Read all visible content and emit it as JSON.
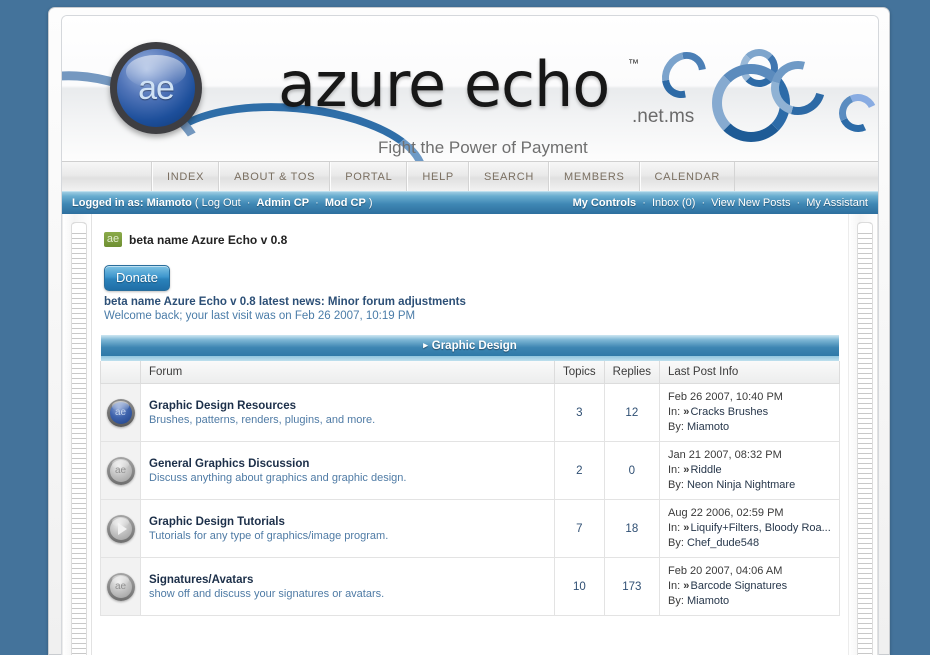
{
  "site": {
    "logo_text": "ae",
    "wordmark": "azure echo",
    "trademark": "™",
    "domain_suffix": ".net.ms",
    "tagline": "Fight the Power of Payment"
  },
  "nav": {
    "items": [
      {
        "label": "INDEX"
      },
      {
        "label": "ABOUT & TOS"
      },
      {
        "label": "PORTAL"
      },
      {
        "label": "HELP"
      },
      {
        "label": "SEARCH"
      },
      {
        "label": "MEMBERS"
      },
      {
        "label": "CALENDAR"
      }
    ]
  },
  "userbar": {
    "logged_in_label": "Logged in as:",
    "username": "Miamoto",
    "paren_open": "(",
    "logout": "Log Out",
    "admin_cp": "Admin CP",
    "mod_cp": "Mod CP",
    "paren_close": ")",
    "my_controls": "My Controls",
    "inbox": "Inbox (0)",
    "view_new_posts": "View New Posts",
    "my_assistant": "My Assistant",
    "separator": "·"
  },
  "board": {
    "badge": "ae",
    "title": "beta name Azure Echo v 0.8",
    "donate_label": "Donate",
    "news_line": "beta name Azure Echo v 0.8 latest news: Minor forum adjustments",
    "welcome_line": "Welcome back; your last visit was on Feb 26 2007, 10:19 PM"
  },
  "category": {
    "arrow": "▸",
    "name": "Graphic Design"
  },
  "table": {
    "headers": {
      "forum": "Forum",
      "topics": "Topics",
      "replies": "Replies",
      "last_post": "Last Post Info"
    },
    "rows": [
      {
        "icon": "forum-icon-new",
        "icon_style": "blue",
        "icon_glyph": "ae",
        "name": "Graphic Design Resources",
        "description": "Brushes, patterns, renders, plugins, and more.",
        "topics": "3",
        "replies": "12",
        "last_date": "Feb 26 2007, 10:40 PM",
        "last_in_label": "In:",
        "last_in_chev": "»",
        "last_topic": "Cracks Brushes",
        "last_by_label": "By:",
        "last_by": "Miamoto"
      },
      {
        "icon": "forum-icon-read",
        "icon_style": "gray",
        "icon_glyph": "ae",
        "name": "General Graphics Discussion",
        "description": "Discuss anything about graphics and graphic design.",
        "topics": "2",
        "replies": "0",
        "last_date": "Jan 21 2007, 08:32 PM",
        "last_in_label": "In:",
        "last_in_chev": "»",
        "last_topic": "Riddle",
        "last_by_label": "By:",
        "last_by": "Neon Ninja Nightmare"
      },
      {
        "icon": "forum-icon-redirect",
        "icon_style": "play",
        "icon_glyph": "",
        "name": "Graphic Design Tutorials",
        "description": "Tutorials for any type of graphics/image program.",
        "topics": "7",
        "replies": "18",
        "last_date": "Aug 22 2006, 02:59 PM",
        "last_in_label": "In:",
        "last_in_chev": "»",
        "last_topic": "Liquify+Filters, Bloody Roa...",
        "last_by_label": "By:",
        "last_by": "Chef_dude548"
      },
      {
        "icon": "forum-icon-read",
        "icon_style": "gray",
        "icon_glyph": "ae",
        "name": "Signatures/Avatars",
        "description": "show off and discuss your signatures or avatars.",
        "topics": "10",
        "replies": "173",
        "last_date": "Feb 20 2007, 04:06 AM",
        "last_in_label": "In:",
        "last_in_chev": "»",
        "last_topic": "Barcode Signatures",
        "last_by_label": "By:",
        "last_by": "Miamoto"
      }
    ]
  },
  "colors": {
    "page_background": "#44739b",
    "userbar_accent": "#3f87b4",
    "category_accent": "#3d85b2",
    "badge_green": "#6e8f32",
    "link_blue": "#4f7ba5"
  }
}
